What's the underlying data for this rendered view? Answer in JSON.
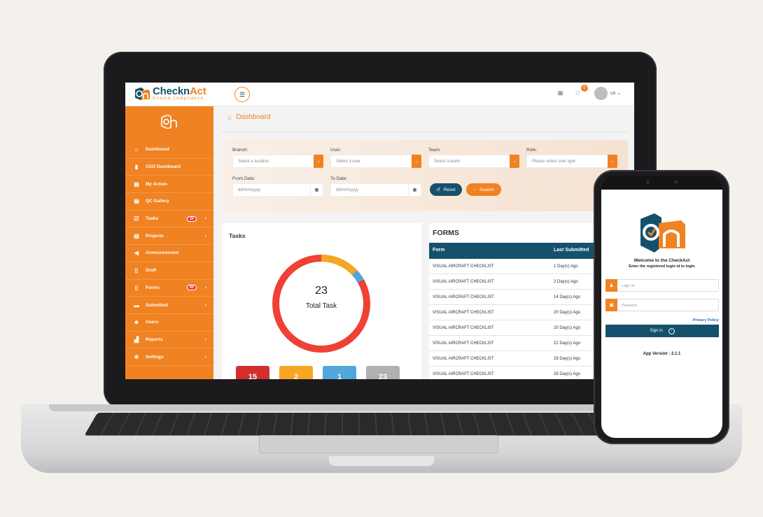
{
  "app": {
    "brand_name_a": "Checkn",
    "brand_name_b": "Act",
    "brand_tagline": "Ensure compliance",
    "accent_color": "#f08221",
    "primary_color": "#15516d"
  },
  "topbar": {
    "notification_count": "0",
    "user_label": "ux",
    "user_chevron": "⌄"
  },
  "sidebar": {
    "items": [
      {
        "label": "Dashboard",
        "icon": "home-icon"
      },
      {
        "label": "CEO Dashboard",
        "icon": "bar-chart-icon"
      },
      {
        "label": "My Action",
        "icon": "clipboard-icon"
      },
      {
        "label": "QC Gallery",
        "icon": "clipboard-icon"
      },
      {
        "label": "Tasks",
        "icon": "checkbox-icon",
        "badge": "24"
      },
      {
        "label": "Projects",
        "icon": "clipboard-icon"
      },
      {
        "label": "Announcement",
        "icon": "megaphone-icon"
      },
      {
        "label": "Draft",
        "icon": "draft-icon"
      },
      {
        "label": "Forms",
        "icon": "form-icon",
        "badge": "69"
      },
      {
        "label": "Submitted",
        "icon": "inbox-icon"
      },
      {
        "label": "Users",
        "icon": "users-icon"
      },
      {
        "label": "Reports",
        "icon": "report-icon"
      },
      {
        "label": "Settings",
        "icon": "gear-icon"
      }
    ]
  },
  "breadcrumb": {
    "title": "Dashboard"
  },
  "filters": {
    "branch_label": "Branch:",
    "branch_placeholder": "Select a location",
    "user_label": "User:",
    "user_placeholder": "Select a user",
    "team_label": "Team:",
    "team_placeholder": "Select a team",
    "role_label": "Role:",
    "role_placeholder": "Please select user type",
    "from_label": "From Date:",
    "from_placeholder": "dd/mm/yyyy",
    "to_label": "To Date:",
    "to_placeholder": "dd/mm/yyyy",
    "reset_label": "Reset",
    "search_label": "Search"
  },
  "tasks": {
    "title": "Tasks",
    "total": "23",
    "total_label": "Total Task",
    "stats": [
      {
        "value": "15",
        "color": "#d32f2f"
      },
      {
        "value": "2",
        "color": "#f5a623"
      },
      {
        "value": "1",
        "color": "#4fa7dc"
      },
      {
        "value": "23",
        "color": "#b0b0b0"
      }
    ]
  },
  "forms": {
    "title": "FORMS",
    "col_form": "Form",
    "col_last": "Last Submitted",
    "rows": [
      {
        "form": "VISUAL AIRCRAFT CHECKLIST",
        "last": "1 Day(s) Ago"
      },
      {
        "form": "VISUAL AIRCRAFT CHECKLIST",
        "last": "2 Day(s) Ago"
      },
      {
        "form": "VISUAL AIRCRAFT CHECKLIST",
        "last": "14 Day(s) Ago"
      },
      {
        "form": "VISUAL AIRCRAFT CHECKLIST",
        "last": "20 Day(s) Ago"
      },
      {
        "form": "VISUAL AIRCRAFT CHECKLIST",
        "last": "20 Day(s) Ago"
      },
      {
        "form": "VISUAL AIRCRAFT CHECKLIST",
        "last": "22 Day(s) Ago"
      },
      {
        "form": "VISUAL AIRCRAFT CHECKLIST",
        "last": "28 Day(s) Ago"
      },
      {
        "form": "VISUAL AIRCRAFT CHECKLIST",
        "last": "28 Day(s) Ago"
      }
    ]
  },
  "phone": {
    "welcome": "Welcome to the CheckAct",
    "subtitle": "Enter the registered login id to login",
    "login_placeholder": "Login Id",
    "password_placeholder": "Password",
    "privacy": "Privacy Policy",
    "signin": "Sign in",
    "version": "App Version : 2.1.1"
  }
}
